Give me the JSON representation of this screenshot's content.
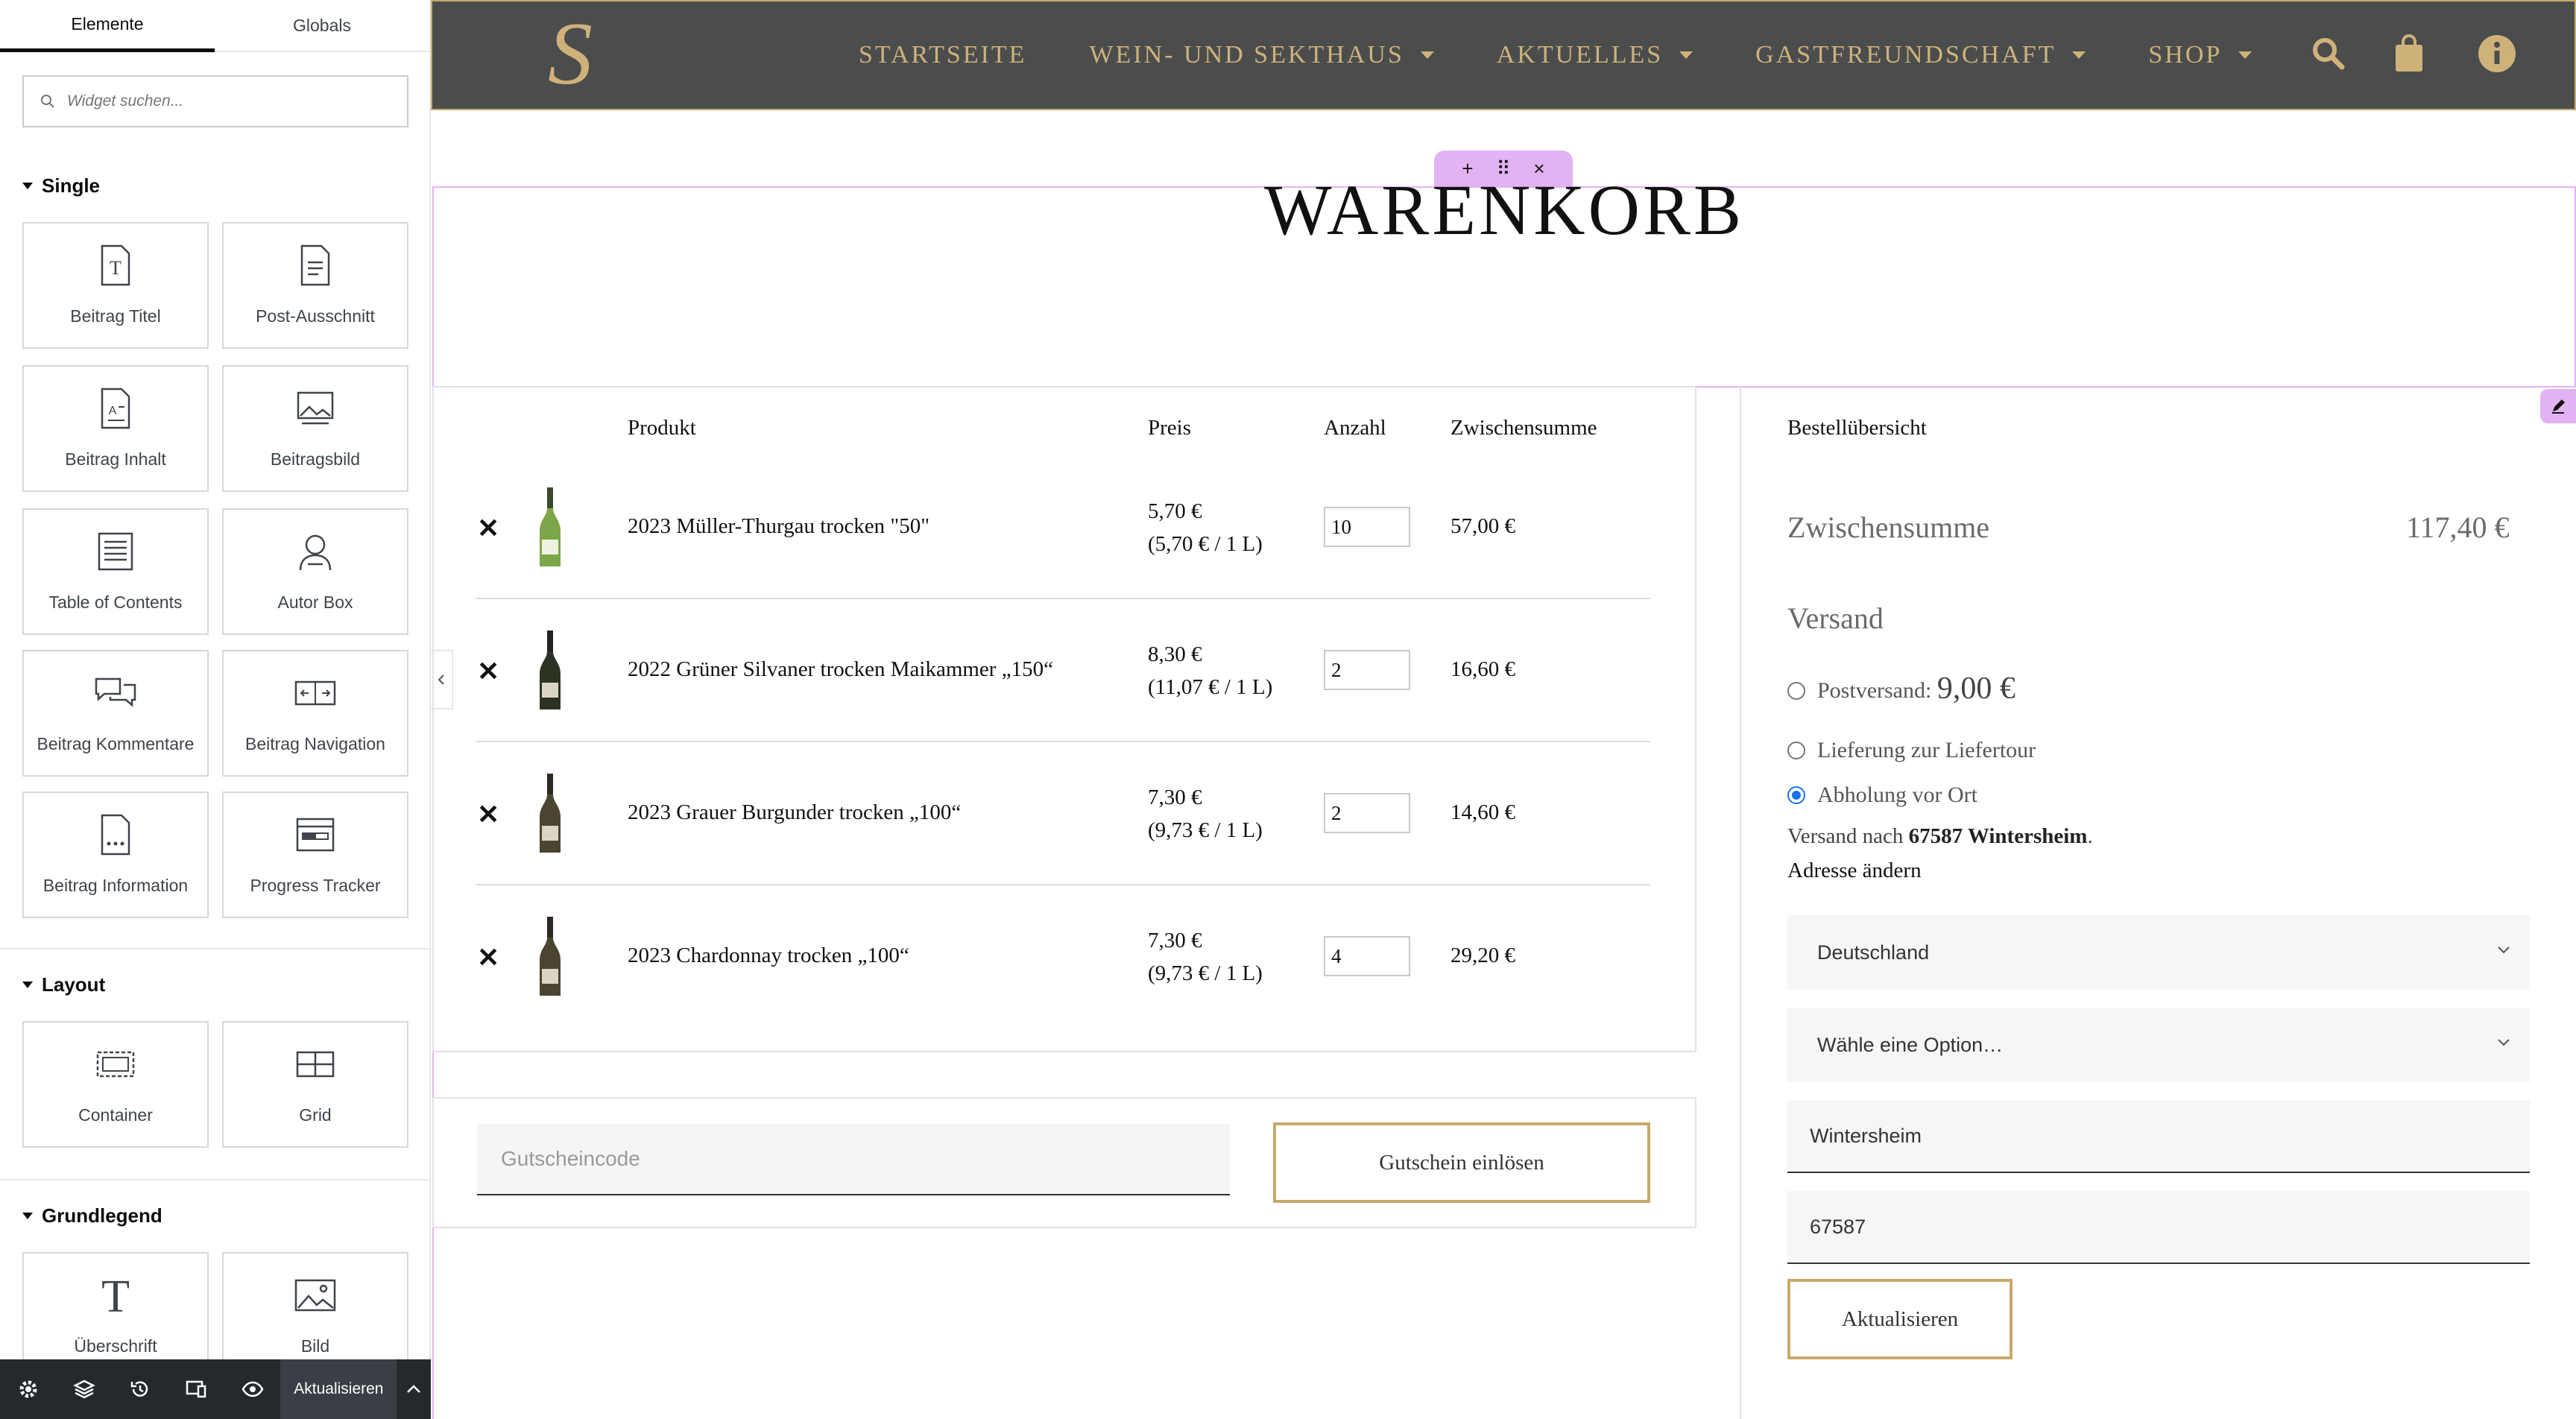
{
  "panel": {
    "tabs": [
      "Elemente",
      "Globals"
    ],
    "search_placeholder": "Widget suchen...",
    "categories": {
      "single": "Single",
      "layout": "Layout",
      "basic": "Grundlegend"
    },
    "single_widgets": [
      {
        "label": "Beitrag Titel",
        "icon": "post-title-icon"
      },
      {
        "label": "Post-Ausschnitt",
        "icon": "post-excerpt-icon"
      },
      {
        "label": "Beitrag Inhalt",
        "icon": "post-content-icon"
      },
      {
        "label": "Beitragsbild",
        "icon": "featured-image-icon"
      },
      {
        "label": "Table of Contents",
        "icon": "table-of-contents-icon"
      },
      {
        "label": "Autor Box",
        "icon": "author-box-icon"
      },
      {
        "label": "Beitrag Kommentare",
        "icon": "comments-icon"
      },
      {
        "label": "Beitrag Navigation",
        "icon": "post-navigation-icon"
      },
      {
        "label": "Beitrag Information",
        "icon": "post-info-icon"
      },
      {
        "label": "Progress Tracker",
        "icon": "progress-tracker-icon"
      }
    ],
    "layout_widgets": [
      {
        "label": "Container",
        "icon": "container-icon"
      },
      {
        "label": "Grid",
        "icon": "grid-icon"
      }
    ],
    "basic_widgets": [
      {
        "label": "Überschrift",
        "icon": "heading-icon"
      },
      {
        "label": "Bild",
        "icon": "image-icon"
      }
    ],
    "footer": {
      "update_label": "Aktualisieren"
    }
  },
  "nav": {
    "logo_letter": "S",
    "items": [
      {
        "label": "STARTSEITE",
        "has_dropdown": false
      },
      {
        "label": "WEIN- UND SEKTHAUS",
        "has_dropdown": true
      },
      {
        "label": "AKTUELLES",
        "has_dropdown": true
      },
      {
        "label": "GASTFREUNDSCHAFT",
        "has_dropdown": true
      },
      {
        "label": "SHOP",
        "has_dropdown": true
      }
    ],
    "gold_color": "#cfb27a",
    "bg_color": "#4b4d4d"
  },
  "page": {
    "title": "WARENKORB",
    "handle": {
      "add": "+",
      "move": "⠿",
      "close": "×"
    }
  },
  "cart": {
    "headers": {
      "product": "Produkt",
      "price": "Preis",
      "qty": "Anzahl",
      "subtotal": "Zwischensumme"
    },
    "rows": [
      {
        "name": "2023 Müller-Thurgau trocken \"50\"",
        "price": "5,70 €",
        "unit_price": "(5,70 € / 1 L)",
        "qty": "10",
        "subtotal": "57,00 €",
        "bottle": "green"
      },
      {
        "name": "2022 Grüner Silvaner trocken Maikammer „150“",
        "price": "8,30 €",
        "unit_price": "(11,07 € / 1 L)",
        "qty": "2",
        "subtotal": "16,60 €",
        "bottle": "dark"
      },
      {
        "name": "2023 Grauer Burgunder trocken „100“",
        "price": "7,30 €",
        "unit_price": "(9,73 € / 1 L)",
        "qty": "2",
        "subtotal": "14,60 €",
        "bottle": "dark"
      },
      {
        "name": "2023 Chardonnay trocken „100“",
        "price": "7,30 €",
        "unit_price": "(9,73 € / 1 L)",
        "qty": "4",
        "subtotal": "29,20 €",
        "bottle": "dark"
      }
    ],
    "remove_symbol": "✕",
    "coupon_placeholder": "Gutscheincode",
    "coupon_button": "Gutschein einlösen"
  },
  "summary": {
    "heading": "Bestellübersicht",
    "subtotal_label": "Zwischensumme",
    "subtotal_value": "117,40 €",
    "shipping_label": "Versand",
    "shipping_options": [
      {
        "label": "Postversand: ",
        "price": "9,00 €",
        "checked": false
      },
      {
        "label": "Lieferung zur Liefertour",
        "price": "",
        "checked": false
      },
      {
        "label": "Abholung vor Ort",
        "price": "",
        "checked": true
      }
    ],
    "ship_to_prefix": "Versand nach ",
    "ship_to_place": "67587 Wintersheim",
    "ship_to_suffix": ".",
    "change_address": "Adresse ändern",
    "country": "Deutschland",
    "state_placeholder": "Wähle eine Option…",
    "city": "Wintersheim",
    "zip": "67587",
    "update_button": "Aktualisieren"
  }
}
